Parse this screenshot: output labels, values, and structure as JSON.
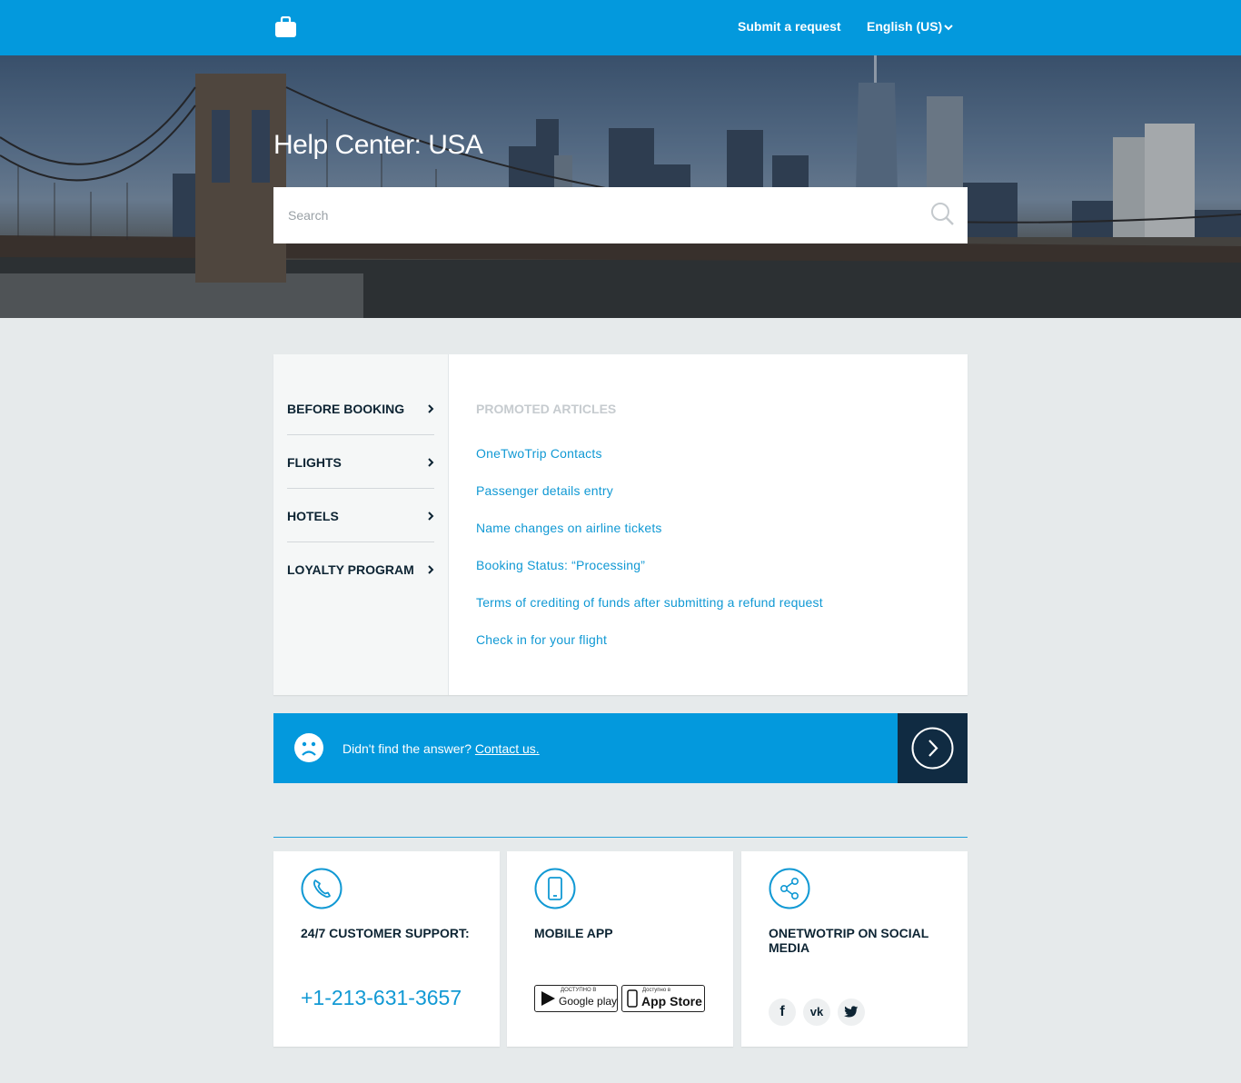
{
  "header": {
    "logo_icon": "briefcase-icon",
    "submit_request": "Submit a request",
    "language": "English (US)"
  },
  "hero": {
    "title": "Help Center: USA",
    "search_placeholder": "Search"
  },
  "sidebar": {
    "items": [
      {
        "label": "BEFORE BOOKING"
      },
      {
        "label": "FLIGHTS"
      },
      {
        "label": "HOTELS"
      },
      {
        "label": "LOYALTY PROGRAM"
      }
    ]
  },
  "promoted": {
    "heading": "PROMOTED ARTICLES",
    "articles": [
      "OneTwoTrip Contacts",
      "Passenger details entry",
      "Name changes on airline tickets",
      "Booking Status: “Processing”",
      "Terms of crediting of funds after submitting a refund request",
      "Check in for your flight"
    ]
  },
  "contact_bar": {
    "text": "Didn't find the answer?",
    "link": "Contact us."
  },
  "cards": {
    "support": {
      "title": "24/7 CUSTOMER SUPPORT:",
      "phone": "+1-213-631-3657"
    },
    "app": {
      "title": "MOBILE APP",
      "google_small": "ДОСТУПНО В",
      "google_big": "Google play",
      "apple_small": "Доступно в",
      "apple_big": "App Store"
    },
    "social": {
      "title": "ONETWOTRIP ON SOCIAL MEDIA",
      "facebook": "f",
      "vk": "vk",
      "twitter": "t"
    }
  },
  "colors": {
    "brand_blue": "#0399dd",
    "dark_navy": "#102b42",
    "link_blue": "#1199d4",
    "page_bg": "#e6eaeb"
  }
}
